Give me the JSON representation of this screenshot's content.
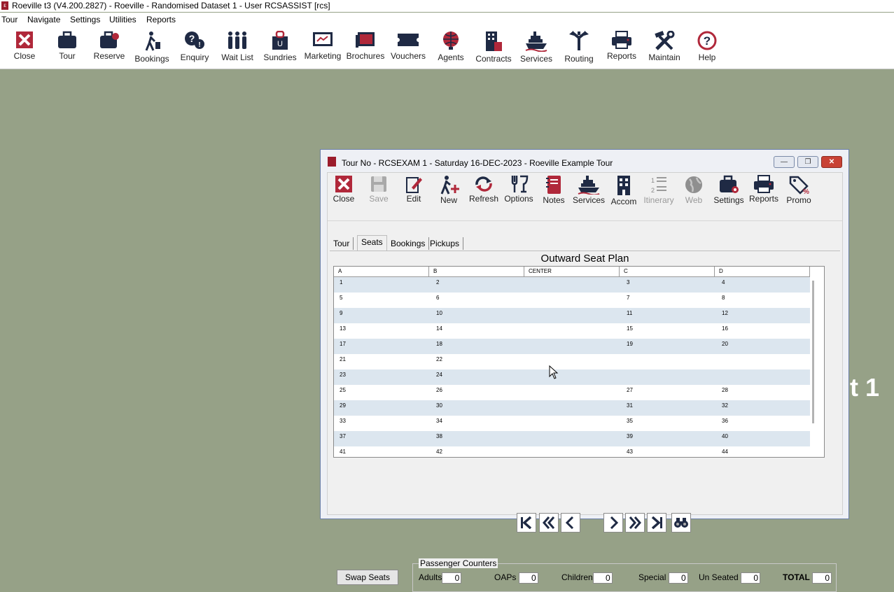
{
  "app": {
    "title": "Roeville t3 (V4.200.2827) - Roeville - Randomised Dataset 1 - User RCSASSIST [rcs]",
    "menu": [
      "Tour",
      "Navigate",
      "Settings",
      "Utilities",
      "Reports"
    ],
    "toolbar": [
      "Close",
      "Tour",
      "Reserve",
      "Bookings",
      "Enquiry",
      "Wait List",
      "Sundries",
      "Marketing",
      "Brochures",
      "Vouchers",
      "Agents",
      "Contracts",
      "Services",
      "Routing",
      "Reports",
      "Maintain",
      "Help"
    ]
  },
  "background_text": "t 1",
  "window": {
    "title": "Tour No - RCSEXAM  1 - Saturday 16-DEC-2023 - Roeville Example Tour",
    "toolbar": [
      {
        "label": "Close",
        "enabled": true
      },
      {
        "label": "Save",
        "enabled": false
      },
      {
        "label": "Edit",
        "enabled": true
      },
      {
        "label": "New",
        "enabled": true
      },
      {
        "label": "Refresh",
        "enabled": true
      },
      {
        "label": "Options",
        "enabled": true
      },
      {
        "label": "Notes",
        "enabled": true
      },
      {
        "label": "Services",
        "enabled": true
      },
      {
        "label": "Accom",
        "enabled": true
      },
      {
        "label": "Itinerary",
        "enabled": false
      },
      {
        "label": "Web",
        "enabled": false
      },
      {
        "label": "Settings",
        "enabled": true
      },
      {
        "label": "Reports",
        "enabled": true
      },
      {
        "label": "Promo",
        "enabled": true
      }
    ],
    "tabs": [
      "Tour",
      "Seats",
      "Bookings",
      "Pickups"
    ],
    "active_tab": "Seats",
    "seat_plan": {
      "title": "Outward Seat Plan",
      "columns": [
        "A",
        "B",
        "CENTER",
        "C",
        "D"
      ],
      "rows": [
        [
          "1",
          "2",
          "",
          "3",
          "4"
        ],
        [
          "5",
          "6",
          "",
          "7",
          "8"
        ],
        [
          "9",
          "10",
          "",
          "11",
          "12"
        ],
        [
          "13",
          "14",
          "",
          "15",
          "16"
        ],
        [
          "17",
          "18",
          "",
          "19",
          "20"
        ],
        [
          "21",
          "22",
          "",
          "",
          ""
        ],
        [
          "23",
          "24",
          "",
          "",
          ""
        ],
        [
          "25",
          "26",
          "",
          "27",
          "28"
        ],
        [
          "29",
          "30",
          "",
          "31",
          "32"
        ],
        [
          "33",
          "34",
          "",
          "35",
          "36"
        ],
        [
          "37",
          "38",
          "",
          "39",
          "40"
        ],
        [
          "41",
          "42",
          "",
          "43",
          "44"
        ]
      ]
    },
    "swap_seats_label": "Swap Seats",
    "counters": {
      "legend": "Passenger Counters",
      "adults_label": "Adults",
      "adults": "0",
      "oaps_label": "OAPs",
      "oaps": "0",
      "children_label": "Children",
      "children": "0",
      "special_label": "Special",
      "special": "0",
      "unseated_label": "Un Seated",
      "unseated": "0",
      "total_label": "TOTAL",
      "total": "0"
    }
  },
  "colors": {
    "desktop": "#96a187",
    "icon_navy": "#1f2a44",
    "icon_red": "#b0283a",
    "row_alt": "#dce6ef"
  }
}
